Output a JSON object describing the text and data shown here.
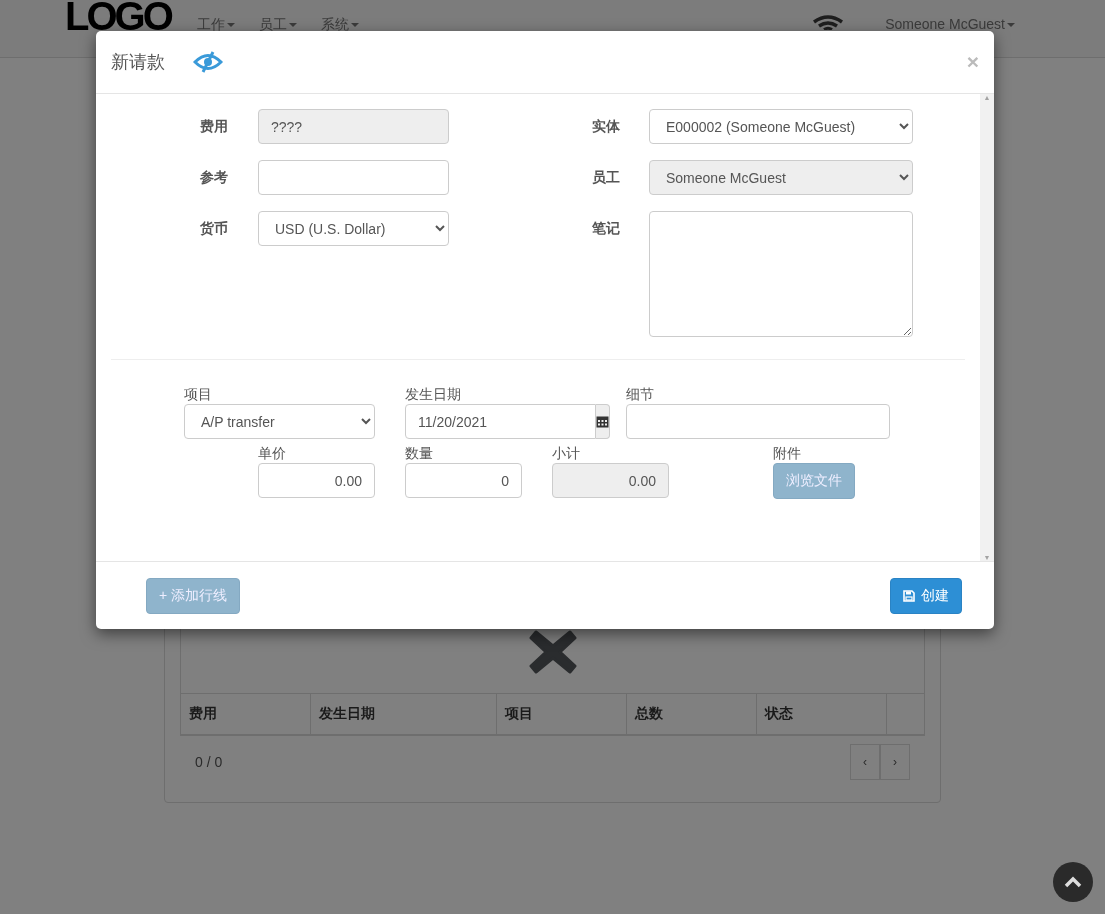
{
  "navbar": {
    "logo": "LOGO",
    "menus": [
      {
        "label": "工作"
      },
      {
        "label": "员工"
      },
      {
        "label": "系统"
      }
    ],
    "user": "Someone McGuest"
  },
  "background": {
    "table": {
      "columns": [
        "费用",
        "发生日期",
        "项目",
        "总数",
        "状态"
      ]
    },
    "pagination": "0 / 0",
    "pager": [
      "‹",
      "›"
    ]
  },
  "modal": {
    "title": "新请款",
    "close": "×",
    "fields_left": [
      {
        "label": "费用",
        "kind": "text",
        "value": "????",
        "readonly": true
      },
      {
        "label": "参考",
        "kind": "text",
        "readonly": false
      },
      {
        "label": "货币",
        "kind": "select",
        "value": "USD (U.S. Dollar)",
        "readonly": false
      }
    ],
    "fields_right": [
      {
        "label": "实体",
        "kind": "select",
        "value": "E000002 (Someone McGuest)",
        "readonly": false
      },
      {
        "label": "员工",
        "kind": "select",
        "value": "Someone McGuest",
        "readonly": true
      },
      {
        "label": "笔记",
        "kind": "textarea",
        "readonly": false
      }
    ],
    "scrollbar": {
      "up": "▲",
      "down": "▼"
    },
    "line": {
      "item": {
        "label": "项目",
        "value": "A/P transfer"
      },
      "date": {
        "label": "发生日期",
        "value": "11/20/2021"
      },
      "detail": {
        "label": "细节"
      },
      "price": {
        "label": "单价",
        "value": "0.00",
        "readonly": false
      },
      "qty": {
        "label": "数量",
        "value": "0",
        "readonly": false
      },
      "subtotal": {
        "label": "小计",
        "value": "0.00",
        "readonly": true
      },
      "attachment": {
        "label": "附件",
        "button": "浏览文件",
        "disabled": true
      }
    },
    "add_line": {
      "label": "+ 添加行线",
      "disabled": true
    },
    "create": {
      "label": "创建",
      "disabled": false
    }
  }
}
